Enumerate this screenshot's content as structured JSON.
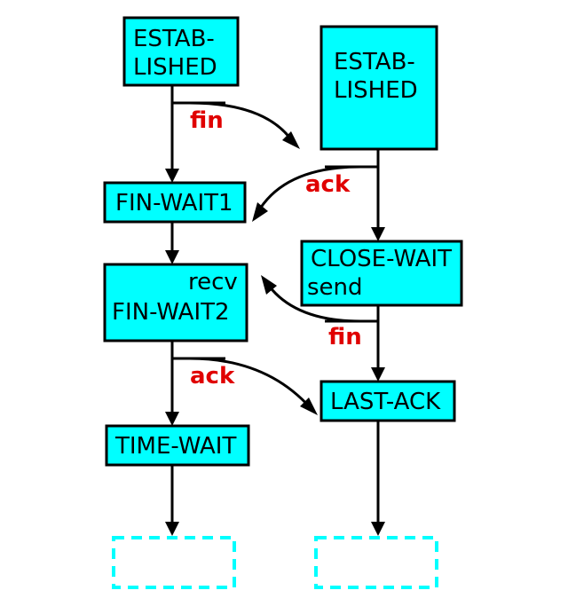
{
  "left": {
    "established": {
      "line1": "ESTAB-",
      "line2": "LISHED"
    },
    "established_out": "fin",
    "fin_wait1": "FIN-WAIT1",
    "fin_wait2": {
      "extra": "recv",
      "label": "FIN-WAIT2"
    },
    "fin_wait2_out": "ack",
    "time_wait": "TIME-WAIT"
  },
  "right": {
    "established": {
      "line1": "ESTAB-",
      "line2": "LISHED"
    },
    "established_out": "ack",
    "close_wait": {
      "label": "CLOSE-WAIT",
      "extra": "send"
    },
    "close_wait_out": "fin",
    "last_ack": "LAST-ACK"
  }
}
